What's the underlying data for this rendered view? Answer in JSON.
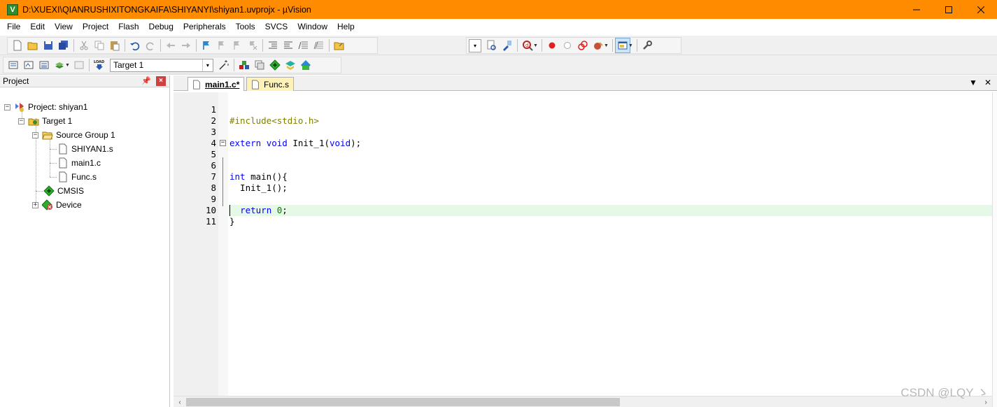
{
  "window": {
    "title": "D:\\XUEXI\\QIANRUSHIXITONGKAIFA\\SHIYANYI\\shiyan1.uvprojx - µVision",
    "app_icon_letter": "V",
    "title_bar_color": "#ff8c00"
  },
  "menu": {
    "items": [
      "File",
      "Edit",
      "View",
      "Project",
      "Flash",
      "Debug",
      "Peripherals",
      "Tools",
      "SVCS",
      "Window",
      "Help"
    ]
  },
  "toolbar2": {
    "load_label": "LOAD",
    "target_select_value": "Target 1"
  },
  "project_panel": {
    "title": "Project",
    "tree": {
      "project": "Project: shiyan1",
      "target": "Target 1",
      "group": "Source Group 1",
      "files": [
        "SHIYAN1.s",
        "main1.c",
        "Func.s"
      ],
      "cmsis": "CMSIS",
      "device": "Device"
    }
  },
  "editor": {
    "tabs": [
      {
        "label": "main1.c*",
        "active": true
      },
      {
        "label": "Func.s",
        "active": false
      }
    ],
    "lines": [
      {
        "n": "1",
        "text": "#include<stdio.h>"
      },
      {
        "n": "2",
        "text": ""
      },
      {
        "n": "3",
        "text": "extern void Init_1(void);"
      },
      {
        "n": "4",
        "text": ""
      },
      {
        "n": "5",
        "text": "int main(){"
      },
      {
        "n": "6",
        "text": ""
      },
      {
        "n": "7",
        "text": "  Init_1();"
      },
      {
        "n": "8",
        "text": ""
      },
      {
        "n": "9",
        "text": "  return 0;"
      },
      {
        "n": "10",
        "text": "}"
      },
      {
        "n": "11",
        "text": ""
      }
    ],
    "current_line": "11",
    "current_line_color": "#e6f8e6",
    "keyword_color": "#0000ff",
    "preprocessor_color": "#808000",
    "number_color": "#008000"
  },
  "watermark": "CSDN @LQY ゝ"
}
